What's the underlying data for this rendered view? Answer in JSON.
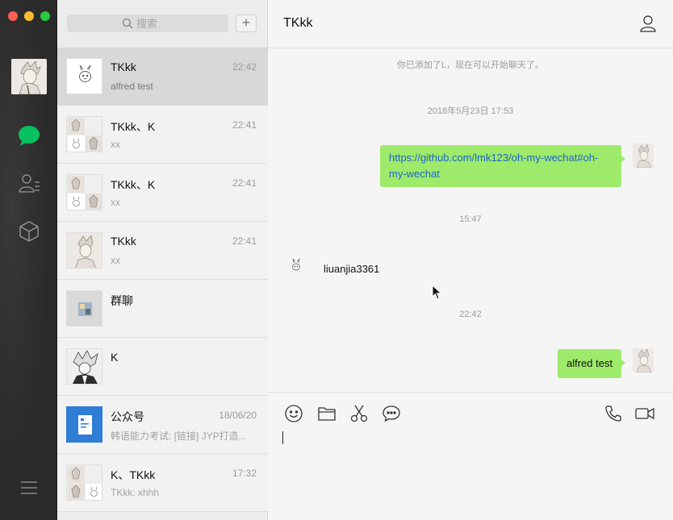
{
  "sidebar": {
    "window_controls": [
      "close",
      "minimize",
      "zoom"
    ],
    "icons": [
      "chat-icon",
      "contacts-icon",
      "favorites-icon",
      "menu-icon"
    ]
  },
  "list": {
    "search_placeholder": "搜索",
    "add_label": "+",
    "conversations": [
      {
        "name": "TKkk",
        "time": "22:42",
        "preview": "alfred test"
      },
      {
        "name": "TKkk、K",
        "time": "22:41",
        "preview": "xx"
      },
      {
        "name": "TKkk、K",
        "time": "22:41",
        "preview": "xx"
      },
      {
        "name": "TKkk",
        "time": "22:41",
        "preview": "xx"
      },
      {
        "name": "群聊",
        "time": "",
        "preview": ""
      },
      {
        "name": "K",
        "time": "",
        "preview": ""
      },
      {
        "name": "公众号",
        "time": "18/06/20",
        "preview": "韩语能力考试: [链接] JYP打造..."
      },
      {
        "name": "K、TKkk",
        "time": "17:32",
        "preview": "TKkk: xhhh"
      }
    ]
  },
  "chat": {
    "title": "TKkk",
    "system_added": "你已添加了L，现在可以开始聊天了。",
    "timestamp_1": "2018年5月23日 17:53",
    "link_message": "https://github.com/lmk123/oh-my-wechat#oh-my-wechat",
    "timestamp_2": "15:47",
    "incoming_message": "liuanjia3361",
    "timestamp_3": "22:42",
    "outgoing_message": "alfred test",
    "toolbar_icons": [
      "emoji-icon",
      "folder-icon",
      "scissors-icon",
      "chat-bubble-icon",
      "phone-icon",
      "video-icon"
    ]
  },
  "colors": {
    "sidebar_bg": "#2b2a2a",
    "active_chat": "#07c160",
    "bubble_out": "#9eea6a",
    "link": "#1d66c8"
  }
}
